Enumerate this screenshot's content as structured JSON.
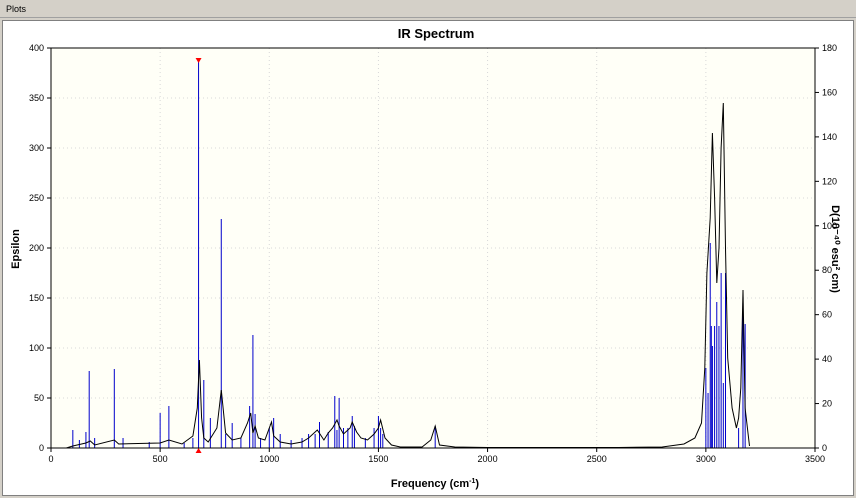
{
  "window": {
    "title": "Plots"
  },
  "colors": {
    "curve": "#000000",
    "sticks": "#0000cc",
    "marker": "#ff0000",
    "plot_bg": "#fffff7"
  },
  "chart_data": {
    "type": "line",
    "title": "IR Spectrum",
    "xlabel": "Frequency (cm",
    "xlabel_sup": "-1",
    "xlabel_close": ")",
    "ylabel": "Epsilon",
    "ylabel_right": "D(10⁻⁴⁰ esu² cm)",
    "xlim": [
      0,
      3500
    ],
    "ylim": [
      0,
      400
    ],
    "ylim_right": [
      0,
      180
    ],
    "xticks": [
      0,
      500,
      1000,
      1500,
      2000,
      2500,
      3000,
      3500
    ],
    "yticks": [
      0,
      50,
      100,
      150,
      200,
      250,
      300,
      350,
      400
    ],
    "yticks_right": [
      0,
      20,
      40,
      60,
      80,
      100,
      120,
      140,
      160,
      180
    ],
    "grid": true,
    "series": [
      {
        "kind": "curve",
        "x": [
          70,
          100,
          160,
          180,
          200,
          290,
          310,
          500,
          540,
          600,
          650,
          670,
          680,
          690,
          700,
          720,
          760,
          780,
          800,
          830,
          870,
          900,
          915,
          925,
          935,
          950,
          980,
          1000,
          1010,
          1020,
          1050,
          1100,
          1150,
          1180,
          1220,
          1250,
          1270,
          1290,
          1310,
          1320,
          1340,
          1370,
          1380,
          1400,
          1420,
          1450,
          1480,
          1500,
          1510,
          1530,
          1560,
          1600,
          1700,
          1740,
          1760,
          1780,
          1850,
          2000,
          2300,
          2600,
          2800,
          2900,
          2950,
          2980,
          2995,
          3005,
          3020,
          3030,
          3040,
          3050,
          3060,
          3070,
          3080,
          3090,
          3100,
          3120,
          3140,
          3150,
          3160,
          3170,
          3180,
          3200
        ],
        "y": [
          0,
          2,
          5,
          7,
          3,
          8,
          4,
          5,
          8,
          4,
          12,
          40,
          88,
          30,
          10,
          6,
          20,
          58,
          15,
          8,
          10,
          25,
          35,
          15,
          22,
          10,
          8,
          20,
          26,
          12,
          6,
          4,
          6,
          10,
          18,
          8,
          15,
          20,
          28,
          22,
          14,
          20,
          26,
          16,
          10,
          8,
          14,
          20,
          28,
          10,
          3,
          1,
          1,
          8,
          22,
          3,
          1,
          0.5,
          0.5,
          0.5,
          1,
          4,
          10,
          25,
          80,
          175,
          230,
          315,
          250,
          165,
          200,
          300,
          345,
          200,
          90,
          40,
          20,
          30,
          60,
          158,
          40,
          2
        ]
      },
      {
        "kind": "sticks",
        "x": [
          100,
          130,
          160,
          175,
          200,
          290,
          330,
          450,
          500,
          540,
          610,
          650,
          676,
          700,
          730,
          780,
          800,
          830,
          870,
          910,
          925,
          935,
          960,
          1000,
          1020,
          1050,
          1100,
          1150,
          1180,
          1210,
          1230,
          1270,
          1300,
          1310,
          1320,
          1340,
          1360,
          1380,
          1390,
          1440,
          1480,
          1500,
          1510,
          1520,
          1760,
          3000,
          3010,
          3020,
          3025,
          3030,
          3040,
          3050,
          3060,
          3070,
          3080,
          3090,
          3150,
          3170,
          3180
        ],
        "y": [
          18,
          8,
          16,
          77,
          10,
          79,
          10,
          6,
          35,
          42,
          5,
          10,
          388,
          68,
          30,
          229,
          14,
          25,
          10,
          42,
          113,
          34,
          10,
          20,
          30,
          14,
          8,
          10,
          14,
          14,
          26,
          16,
          52,
          18,
          50,
          20,
          20,
          32,
          22,
          10,
          20,
          32,
          20,
          14,
          22,
          80,
          55,
          205,
          122,
          102,
          122,
          146,
          122,
          175,
          65,
          175,
          20,
          145,
          124
        ]
      }
    ],
    "marker_x": 676
  }
}
